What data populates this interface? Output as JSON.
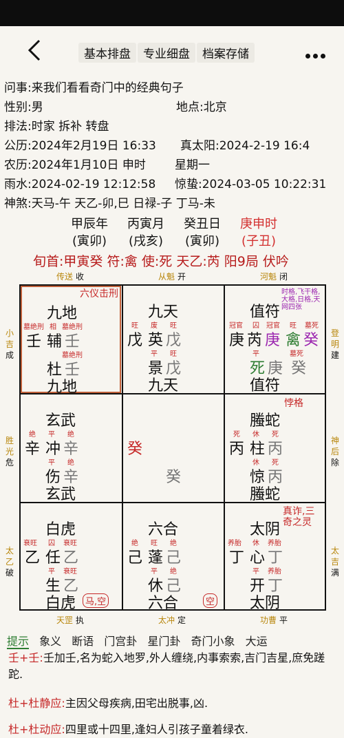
{
  "nav": {
    "tabs": [
      "基本排盘",
      "专业细盘",
      "档案存储"
    ]
  },
  "info": {
    "question_label": "问事:",
    "question": "来我们看看奇门中的经典句子",
    "gender_label": "性别:",
    "gender": "男",
    "place_label": "地点:",
    "place": "北京",
    "method_label": "排法:",
    "method": "时家 拆补 转盘",
    "solar_label": "公历:",
    "solar": "2024年2月19日 16:33",
    "true_sun_label": "真太阳:",
    "true_sun": "2024-2-19 16:4",
    "lunar_label": "农历:",
    "lunar": "2024年1月10日 申时",
    "weekday": "星期一",
    "term1_label": "雨水:",
    "term1": "2024-02-19 12:12:58",
    "term2_label": "惊蛰:",
    "term2": "2024-03-05 10:22:31",
    "shensha_label": "神煞:",
    "shensha": "天马-午 天乙-卯,巳 日禄-子 丁马-未"
  },
  "pillars": [
    {
      "top": "甲辰年",
      "bottom": "(寅卯)"
    },
    {
      "top": "丙寅月",
      "bottom": "(戌亥)"
    },
    {
      "top": "癸丑日",
      "bottom": "(寅卯)"
    },
    {
      "top": "庚申时",
      "bottom": "(子丑)"
    }
  ],
  "xunshou": "旬首:甲寅癸 符:禽 使:死 天乙:芮 阳9局 伏吟",
  "edges": {
    "top": [
      "传送",
      "收",
      "从魁",
      "开",
      "河魁",
      "闭"
    ],
    "bottom": [
      "天罡",
      "执",
      "太冲",
      "定",
      "功曹",
      "平"
    ],
    "left": [
      [
        "小",
        "吉",
        "成"
      ],
      [
        "胜",
        "光",
        "危"
      ],
      [
        "太",
        "乙",
        "破"
      ]
    ],
    "right": [
      [
        "登",
        "明",
        "建"
      ],
      [
        "神",
        "后",
        "除"
      ],
      [
        "太",
        "吉",
        "满"
      ]
    ]
  },
  "palaces": {
    "p1": {
      "corner": "六仪击刑",
      "god": "九地",
      "s1": "墓绝刑",
      "s2": "相",
      "s3": "墓绝刑",
      "c1": "壬",
      "star": "辅",
      "c2": "壬",
      "s4": "墓绝刑",
      "door": "杜",
      "c3": "壬",
      "god2": "九地"
    },
    "p2": {
      "god": "九天",
      "s1": "旺",
      "s2": "废",
      "s3": "旺",
      "c1": "戊",
      "star": "英",
      "c2": "戊",
      "s4": "平",
      "s5": "旺",
      "door": "景",
      "c3": "戊",
      "god2": "九天"
    },
    "p3": {
      "corner": "时格,飞干格,大格,日格,天网四张",
      "god": "值符",
      "s1": "冠官",
      "s2": "囚",
      "s3": "冠官",
      "s3b": "旺",
      "s3c": "墓死",
      "c1": "庚",
      "star": "芮",
      "c2": "庚",
      "c2b": "禽",
      "c2c": "癸",
      "s4": "平",
      "s5": "墓死",
      "door": "死",
      "c3": "庚",
      "c3b": "癸",
      "god2": "值符"
    },
    "p4": {
      "god": "玄武",
      "s1": "绝",
      "s2": "平",
      "s3": "绝",
      "c1": "辛",
      "star": "冲",
      "c2": "辛",
      "s4": "平",
      "s5": "绝",
      "door": "伤",
      "c3": "辛",
      "god2": "玄武"
    },
    "p5": {
      "c1": "癸",
      "c2": "癸"
    },
    "p6": {
      "corner": "悖格",
      "god": "螣蛇",
      "s1": "死",
      "s2": "休",
      "s3": "死",
      "c1": "丙",
      "star": "柱",
      "c2": "丙",
      "s4": "休",
      "s5": "死",
      "door": "惊",
      "c3": "丙",
      "god2": "螣蛇"
    },
    "p7": {
      "god": "白虎",
      "s1": "衰旺",
      "s2": "囚",
      "s3": "衰旺",
      "c1": "乙",
      "star": "任",
      "c2": "乙",
      "s4": "平",
      "s5": "衰旺",
      "door": "生",
      "c3": "乙",
      "god2": "白虎",
      "badge": "马,空"
    },
    "p8": {
      "god": "六合",
      "s1": "绝",
      "s2": "旺",
      "s3": "绝",
      "c1": "己",
      "star": "蓬",
      "c2": "己",
      "s4": "平",
      "s5": "绝",
      "door": "休",
      "c3": "己",
      "god2": "六合",
      "badge": "空"
    },
    "p9": {
      "corner": "真诈,三奇之灵",
      "god": "太阴",
      "s1": "养胎",
      "s2": "休",
      "s3": "养胎",
      "c1": "丁",
      "star": "心",
      "c2": "丁",
      "s4": "平",
      "s5": "养胎",
      "door": "开",
      "c3": "丁",
      "god2": "太阴"
    }
  },
  "tips": {
    "items": [
      "提示",
      "象义",
      "断语",
      "门宫卦",
      "星门卦",
      "奇门小象",
      "大运"
    ]
  },
  "paras": [
    {
      "label": "壬+壬:",
      "text": "壬加壬,名为蛇入地罗,外人缠绕,内事索索,吉门吉星,庶免蹉跎."
    },
    {
      "label": "杜+杜静应:",
      "text": "主因父母疾病,田宅出脱事,凶."
    },
    {
      "label": "杜+杜动应:",
      "text": "四里或十四里,逢妇人引孩子童着绿衣."
    }
  ],
  "colors": {
    "accent_red": "#c62828",
    "edge_gold": "#b8860b",
    "purple": "#9c27b0",
    "green": "#2e7d32"
  }
}
